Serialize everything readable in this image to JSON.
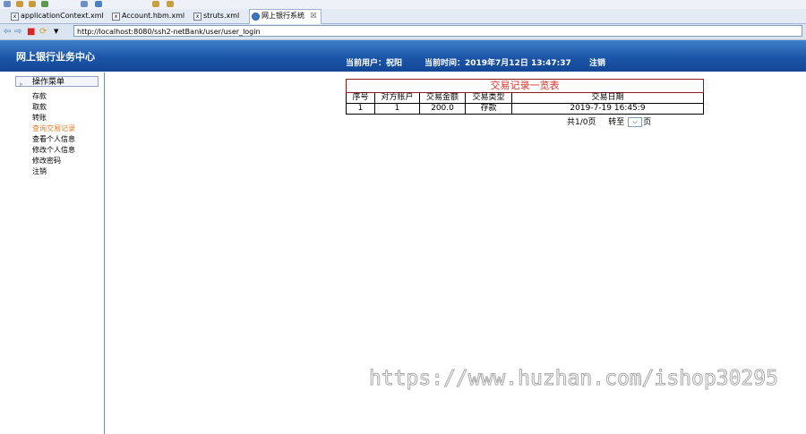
{
  "browser": {
    "tabs": [
      {
        "label": "applicationContext.xml",
        "icon": "xml-file-icon"
      },
      {
        "label": "Account.hbm.xml",
        "icon": "xml-file-icon"
      },
      {
        "label": "struts.xml",
        "icon": "xml-file-icon"
      },
      {
        "label": "网上银行系统",
        "icon": "globe-icon",
        "close": "☒"
      }
    ],
    "url": "http://localhost:8080/ssh2-netBank/user/user_login"
  },
  "header": {
    "logo": "网上银行业务中心",
    "current_user": "当前用户：祝阳",
    "current_time": "当前时间：2019年7月12日 13:47:37",
    "logout": "注销"
  },
  "sidebar": {
    "menu_title": "操作菜单",
    "items": [
      {
        "label": "存款"
      },
      {
        "label": "取款"
      },
      {
        "label": "转账"
      },
      {
        "label": "查询交易记录",
        "active": true
      },
      {
        "label": "查看个人信息"
      },
      {
        "label": "修改个人信息"
      },
      {
        "label": "修改密码"
      },
      {
        "label": "注销"
      }
    ]
  },
  "records": {
    "title": "交易记录一览表",
    "columns": [
      "序号",
      "对方账户",
      "交易金额",
      "交易类型",
      "交易日期"
    ],
    "rows": [
      [
        "1",
        "1",
        "200.0",
        "存款",
        "2019-7-19 16:45:9"
      ]
    ]
  },
  "pager": {
    "summary": "共1/0页",
    "goto_label": "转至",
    "page_suffix": "页",
    "select_value": ""
  },
  "watermark": "https://www.huzhan.com/ishop30295",
  "colors": {
    "header": "#1c55a8",
    "title_red": "#e0302a",
    "active_menu": "#e87a20"
  }
}
